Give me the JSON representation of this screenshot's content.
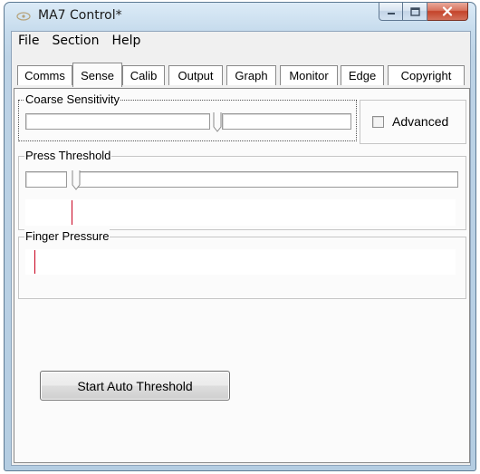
{
  "window": {
    "title": "MA7 Control*"
  },
  "menu": [
    "File",
    "Section",
    "Help"
  ],
  "tabs": [
    {
      "label": "Comms",
      "active": false
    },
    {
      "label": "Sense",
      "active": true
    },
    {
      "label": "Calib",
      "active": false
    },
    {
      "label": "Output",
      "active": false
    },
    {
      "label": "Graph",
      "active": false
    },
    {
      "label": "Monitor",
      "active": false
    },
    {
      "label": "Edge",
      "active": false
    },
    {
      "label": "Copyright",
      "active": false
    }
  ],
  "coarse_sensitivity": {
    "label": "Coarse Sensitivity",
    "advanced_label": "Advanced",
    "advanced_checked": false
  },
  "press_threshold": {
    "label": "Press Threshold"
  },
  "finger_pressure": {
    "label": "Finger Pressure"
  },
  "actions": {
    "start_auto_threshold": "Start Auto Threshold"
  },
  "colors": {
    "marker": "#c8001e",
    "tab_page": "#fbfbfb",
    "client": "#f0f0f0"
  }
}
